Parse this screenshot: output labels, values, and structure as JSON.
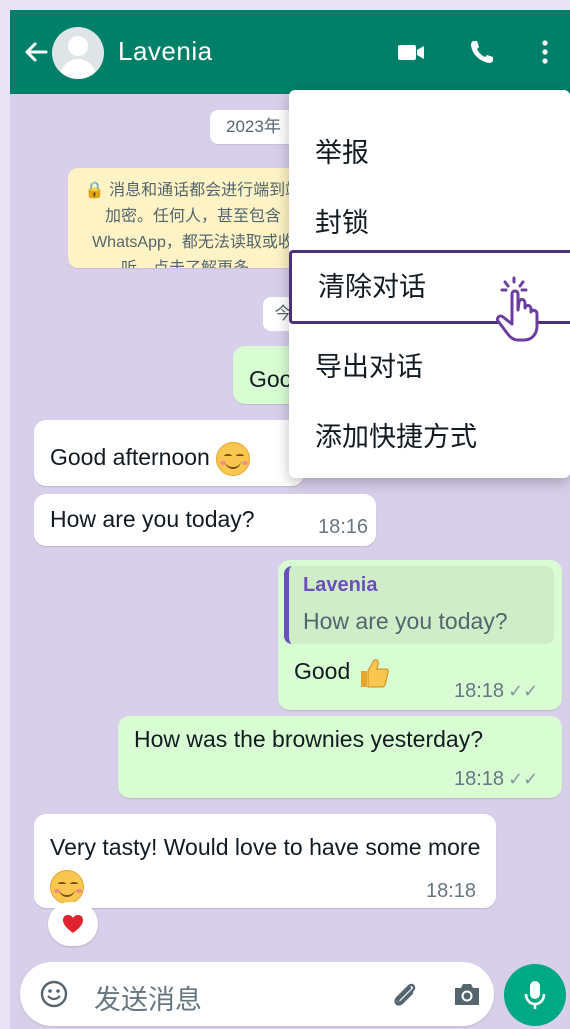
{
  "header": {
    "contact_name": "Lavenia",
    "bg_color": "#008069"
  },
  "chat": {
    "date_label": "2023年",
    "encryption_text": "🔒 消息和通话都会进行端到端加密。任何人，甚至包含 WhatsApp，都无法读取或收听。点击了解更多。",
    "today_label": "今",
    "messages": [
      {
        "dir": "out",
        "text": "Good"
      },
      {
        "dir": "in",
        "text": "Good afternoon"
      },
      {
        "dir": "in",
        "text": "How are you today?",
        "time": "18:16"
      },
      {
        "dir": "out",
        "quote_name": "Lavenia",
        "quote_text": "How are you today?",
        "text": "Good",
        "time": "18:18"
      },
      {
        "dir": "out",
        "text": "How was the brownies yesterday?",
        "time": "18:18"
      },
      {
        "dir": "in",
        "text": "Very tasty! Would love to have some more",
        "time": "18:18"
      }
    ]
  },
  "input": {
    "placeholder": "发送消息"
  },
  "menu": {
    "items": [
      "举报",
      "封锁",
      "清除对话",
      "导出对话",
      "添加快捷方式"
    ]
  }
}
